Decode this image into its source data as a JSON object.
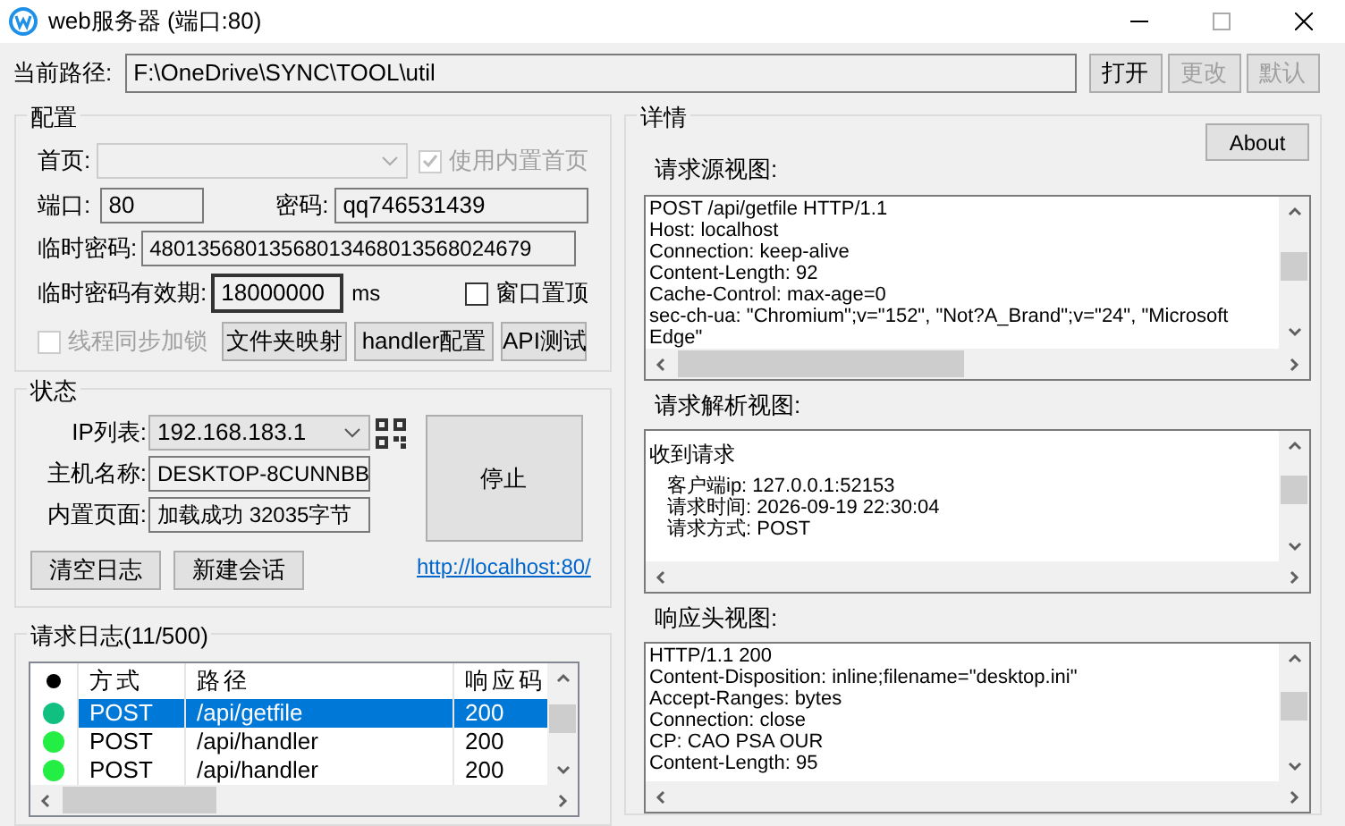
{
  "window": {
    "title": "web服务器 (端口:80)"
  },
  "path": {
    "label": "当前路径:",
    "value": "F:\\OneDrive\\SYNC\\TOOL\\util",
    "buttons": [
      {
        "label": "打开",
        "disabled": false
      },
      {
        "label": "更改",
        "disabled": true
      },
      {
        "label": "默认",
        "disabled": true
      }
    ]
  },
  "config": {
    "title": "配置",
    "homepage": {
      "label": "首页:",
      "disabled": true
    },
    "use_builtin": {
      "label": "使用内置首页",
      "checked": true,
      "disabled": true
    },
    "port": {
      "label": "端口:",
      "value": "80"
    },
    "password": {
      "label": "密码:",
      "value": "qq746531439"
    },
    "temp_password": {
      "label": "临时密码:",
      "value": "48013568013568013468013568024679"
    },
    "temp_expiry": {
      "label": "临时密码有效期:",
      "value": "18000000",
      "unit": "ms"
    },
    "always_on_top": {
      "label": "窗口置顶",
      "checked": false,
      "disabled": false
    },
    "thread_lock": {
      "label": "线程同步加锁",
      "checked": false,
      "disabled": true
    },
    "buttons": [
      "文件夹映射",
      "handler配置",
      "API测试"
    ]
  },
  "status": {
    "title": "状态",
    "ip": {
      "label": "IP列表:",
      "value": "192.168.183.1"
    },
    "host": {
      "label": "主机名称:",
      "value": "DESKTOP-8CUNNBB"
    },
    "page": {
      "label": "内置页面:",
      "value": "加载成功 32035字节"
    },
    "stop_button": "停止",
    "buttons": [
      "清空日志",
      "新建会话"
    ],
    "link": "http://localhost:80/"
  },
  "log": {
    "title": "请求日志(11/500)",
    "columns": [
      "方式",
      "路径",
      "响应码"
    ],
    "rows": [
      {
        "color": "#10c080",
        "method": "POST",
        "path": "/api/getfile",
        "code": "200",
        "selected": true
      },
      {
        "color": "#22ee44",
        "method": "POST",
        "path": "/api/handler",
        "code": "200",
        "selected": false
      },
      {
        "color": "#22ee44",
        "method": "POST",
        "path": "/api/handler",
        "code": "200",
        "selected": false
      }
    ]
  },
  "details": {
    "title": "详情",
    "about": "About",
    "views": [
      {
        "label": "请求源视图:",
        "lines": [
          "POST /api/getfile HTTP/1.1",
          "Host: localhost",
          "Connection: keep-alive",
          "Content-Length: 92",
          "Cache-Control: max-age=0",
          "sec-ch-ua: \"Chromium\";v=\"152\", \"Not?A_Brand\";v=\"24\", \"Microsoft Edge\""
        ]
      },
      {
        "label": "请求解析视图:",
        "heading": "收到请求",
        "lines": [
          "客户端ip: 127.0.0.1:52153",
          "请求时间: 2026-09-19 22:30:04",
          "请求方式: POST"
        ]
      },
      {
        "label": "响应头视图:",
        "lines": [
          "HTTP/1.1 200",
          "Content-Disposition: inline;filename=\"desktop.ini\"",
          "Accept-Ranges: bytes",
          "Connection: close",
          "CP: CAO PSA OUR",
          "Content-Length: 95"
        ]
      }
    ]
  }
}
